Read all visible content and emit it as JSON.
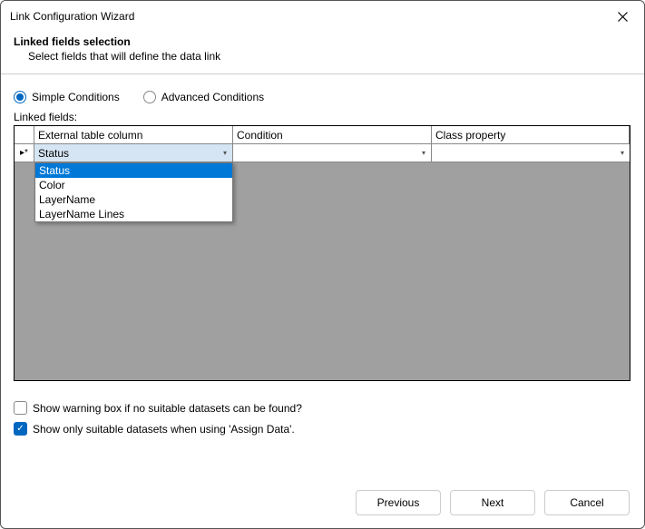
{
  "window": {
    "title": "Link Configuration Wizard"
  },
  "header": {
    "title": "Linked fields selection",
    "subtitle": "Select fields that will define the data link"
  },
  "conditions": {
    "simple_label": "Simple Conditions",
    "advanced_label": "Advanced Conditions",
    "selected": "simple"
  },
  "linked_fields_label": "Linked fields:",
  "grid": {
    "columns": {
      "external": "External table column",
      "condition": "Condition",
      "class_property": "Class property"
    },
    "row_indicator": "▸*",
    "current_cell_value": "Status",
    "dropdown_options": [
      "Status",
      "Color",
      "LayerName",
      "LayerName Lines"
    ],
    "dropdown_selected_index": 0
  },
  "checkboxes": {
    "warning_label": "Show warning box if no suitable datasets can be found?",
    "warning_checked": false,
    "suitable_label": "Show only suitable datasets when using 'Assign Data'.",
    "suitable_checked": true
  },
  "buttons": {
    "previous": "Previous",
    "next": "Next",
    "cancel": "Cancel"
  }
}
